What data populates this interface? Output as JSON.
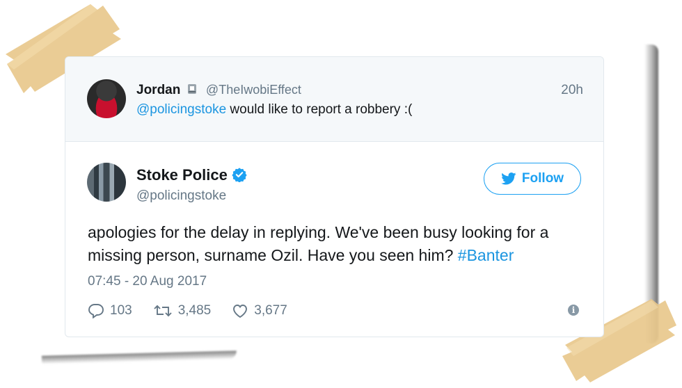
{
  "reply": {
    "name": "Jordan",
    "handle": "@TheIwobiEffect",
    "time": "20h",
    "mention": "@policingstoke",
    "text": " would like to report a robbery :("
  },
  "tweet": {
    "name": "Stoke Police",
    "handle": "@policingstoke",
    "follow_label": "Follow",
    "body": "apologies for the delay in replying. We've been busy looking for a missing person, surname Ozil. Have you seen him? ",
    "hashtag": "#Banter",
    "date": "07:45 - 20 Aug 2017",
    "replies": "103",
    "retweets": "3,485",
    "likes": "3,677"
  },
  "colors": {
    "accent": "#1da1f2",
    "link": "#1b95e0",
    "muted": "#657786",
    "tape": "#e9c98c"
  },
  "icons": [
    "badge-icon",
    "verified-icon",
    "bird-icon",
    "reply-icon",
    "retweet-icon",
    "heart-icon",
    "info-icon"
  ]
}
